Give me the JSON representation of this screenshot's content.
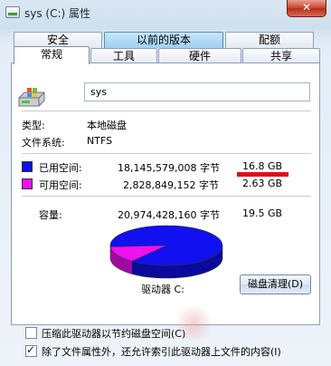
{
  "window": {
    "title": "sys (C:) 属性",
    "close_glyph": "✕"
  },
  "tabs": {
    "security": "安全",
    "previous_versions": "以前的版本",
    "quota": "配额",
    "general": "常规",
    "tools": "工具",
    "hardware": "硬件",
    "sharing": "共享"
  },
  "general": {
    "drive_name": "sys",
    "type_label": "类型:",
    "type_value": "本地磁盘",
    "fs_label": "文件系统:",
    "fs_value": "NTFS",
    "used_label": "已用空间:",
    "used_bytes": "18,145,579,008 字节",
    "used_size": "16.8 GB",
    "free_label": "可用空间:",
    "free_bytes": "2,828,849,152 字节",
    "free_size": "2.63 GB",
    "capacity_label": "容量:",
    "capacity_bytes": "20,974,428,160 字节",
    "capacity_size": "19.5 GB",
    "drive_label": "驱动器 C:",
    "cleanup_button": "磁盘清理(D)",
    "compress_label": "压缩此驱动器以节约磁盘空间(C)",
    "compress_checked": false,
    "index_label": "除了文件属性外，还允许索引此驱动器上文件的内容(I)",
    "index_checked": true
  },
  "colors": {
    "used": "#1010f0",
    "free": "#f010f0",
    "annotation": "#e0101a"
  },
  "chart_data": {
    "type": "pie",
    "categories": [
      "已用空间",
      "可用空间"
    ],
    "values": [
      18145579008,
      2828849152
    ],
    "title": "",
    "style": "3d"
  }
}
